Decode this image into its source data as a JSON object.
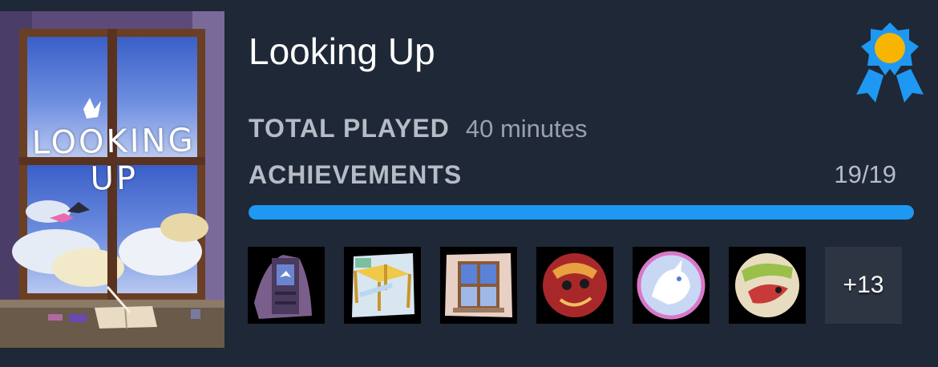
{
  "game": {
    "cover_title": "LOOKING UP",
    "title": "Looking Up"
  },
  "stats": {
    "total_played_label": "TOTAL PLAYED",
    "total_played_value": "40 minutes",
    "achievements_label": "ACHIEVEMENTS",
    "achievements_count": "19/19",
    "achievements_progress": 1.0
  },
  "achievements": {
    "visible_icons": [
      "tower-bird-achievement-icon",
      "golden-table-achievement-icon",
      "window-achievement-icon",
      "red-creature-achievement-icon",
      "white-spirit-achievement-icon",
      "red-fish-achievement-icon"
    ],
    "more_label": "+13"
  },
  "badge": {
    "icon": "gold-ribbon-badge-icon",
    "color_ribbon": "#1e98f2",
    "color_medal": "#f7b500"
  },
  "colors": {
    "background": "#1f2837",
    "progress_fill": "#1e98f2",
    "progress_track": "#3a4558"
  }
}
